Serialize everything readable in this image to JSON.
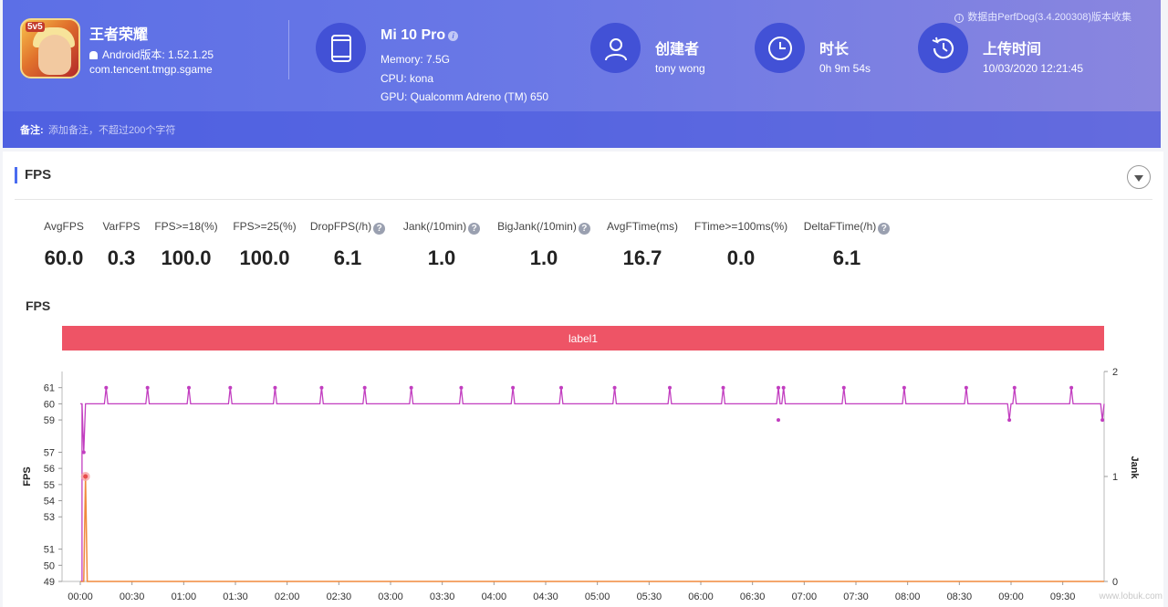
{
  "header": {
    "app": {
      "name": "王者荣耀",
      "version": "Android版本: 1.52.1.25",
      "package": "com.tencent.tmgp.sgame",
      "icon_text": "5v5"
    },
    "device": {
      "name": "Mi 10 Pro",
      "memory": "Memory: 7.5G",
      "cpu": "CPU: kona",
      "gpu": "GPU: Qualcomm Adreno (TM) 650"
    },
    "creator": {
      "title": "创建者",
      "value": "tony wong"
    },
    "duration": {
      "title": "时长",
      "value": "0h 9m 54s"
    },
    "upload": {
      "title": "上传时间",
      "value": "10/03/2020 12:21:45"
    },
    "data_source": "数据由PerfDog(3.4.200308)版本收集",
    "note_label": "备注:",
    "note_placeholder": "添加备注，不超过200个字符",
    "colors": {
      "primary": "#5c6fe6",
      "icon_bg": "#4251d6"
    }
  },
  "section": {
    "title": "FPS"
  },
  "stats": [
    {
      "label": "AvgFPS",
      "value": "60.0",
      "help": false
    },
    {
      "label": "VarFPS",
      "value": "0.3",
      "help": false
    },
    {
      "label": "FPS>=18(%)",
      "value": "100.0",
      "help": false
    },
    {
      "label": "FPS>=25(%)",
      "value": "100.0",
      "help": false
    },
    {
      "label": "DropFPS(/h)",
      "value": "6.1",
      "help": true
    },
    {
      "label": "Jank(/10min)",
      "value": "1.0",
      "help": true
    },
    {
      "label": "BigJank(/10min)",
      "value": "1.0",
      "help": true
    },
    {
      "label": "AvgFTime(ms)",
      "value": "16.7",
      "help": false
    },
    {
      "label": "FTime>=100ms(%)",
      "value": "0.0",
      "help": false
    },
    {
      "label": "DeltaFTime(/h)",
      "value": "6.1",
      "help": true
    }
  ],
  "chart_title": "FPS",
  "chart_data": {
    "type": "line",
    "label_band": "label1",
    "label_color": "#ee5466",
    "x_ticks": [
      "00:00",
      "00:30",
      "01:00",
      "01:30",
      "02:00",
      "02:30",
      "03:00",
      "03:30",
      "04:00",
      "04:30",
      "05:00",
      "05:30",
      "06:00",
      "06:30",
      "07:00",
      "07:30",
      "08:00",
      "08:30",
      "09:00",
      "09:30"
    ],
    "x_range_sec": [
      0,
      594
    ],
    "ylabel": "FPS",
    "y_ticks": [
      49,
      50,
      51,
      53,
      54,
      55,
      56,
      57,
      59,
      60,
      61
    ],
    "ylim": [
      49,
      62
    ],
    "y2label": "Jank",
    "y2_ticks": [
      0,
      1,
      2
    ],
    "y2lim": [
      0,
      2
    ],
    "series": [
      {
        "name": "FPS",
        "color": "#c23ec0",
        "baseline": 60,
        "spikes_up_sec": [
          15,
          39,
          63,
          87,
          113,
          140,
          165,
          192,
          221,
          251,
          279,
          310,
          342,
          373,
          405,
          408,
          443,
          478,
          514,
          542,
          575
        ],
        "spikes_down_sec": [
          405,
          539,
          593
        ],
        "spike_up_value": 61,
        "spike_down_value": 59,
        "start_values": [
          {
            "t": 0,
            "v": 60
          },
          {
            "t": 1,
            "v": 60
          },
          {
            "t": 2,
            "v": 57
          },
          {
            "t": 3,
            "v": 60
          }
        ]
      },
      {
        "name": "Jank",
        "color": "#f08a3c",
        "axis": "right",
        "points": [
          {
            "t": 0,
            "v": 0
          },
          {
            "t": 2,
            "v": 0
          },
          {
            "t": 3,
            "v": 1
          },
          {
            "t": 4,
            "v": 0
          },
          {
            "t": 594,
            "v": 0
          }
        ]
      }
    ],
    "highlight": {
      "t": 3,
      "v": 1
    }
  },
  "watermark": "www.lobuk.com"
}
